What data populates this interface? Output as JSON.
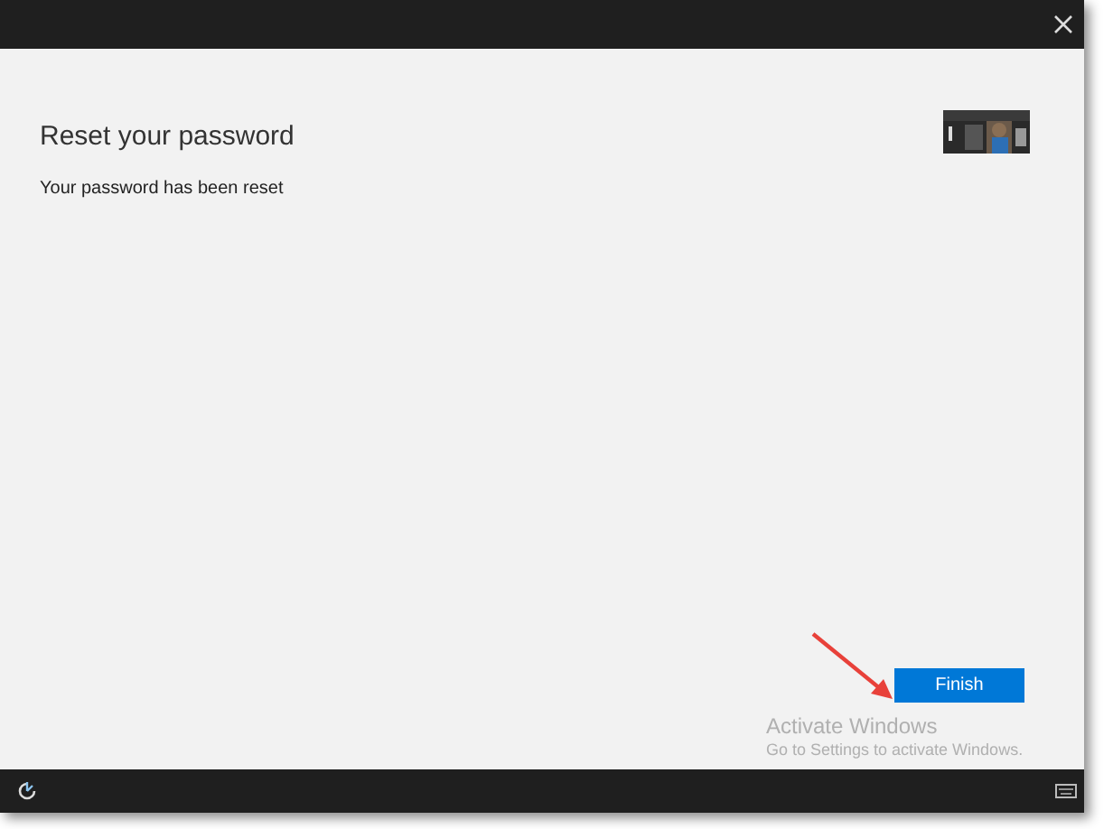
{
  "title": "Reset your password",
  "message": "Your password has been reset",
  "watermark": {
    "heading": "Activate Windows",
    "detail": "Go to Settings to activate Windows."
  },
  "buttons": [
    {
      "label": "Finish",
      "kind": "primary"
    }
  ]
}
